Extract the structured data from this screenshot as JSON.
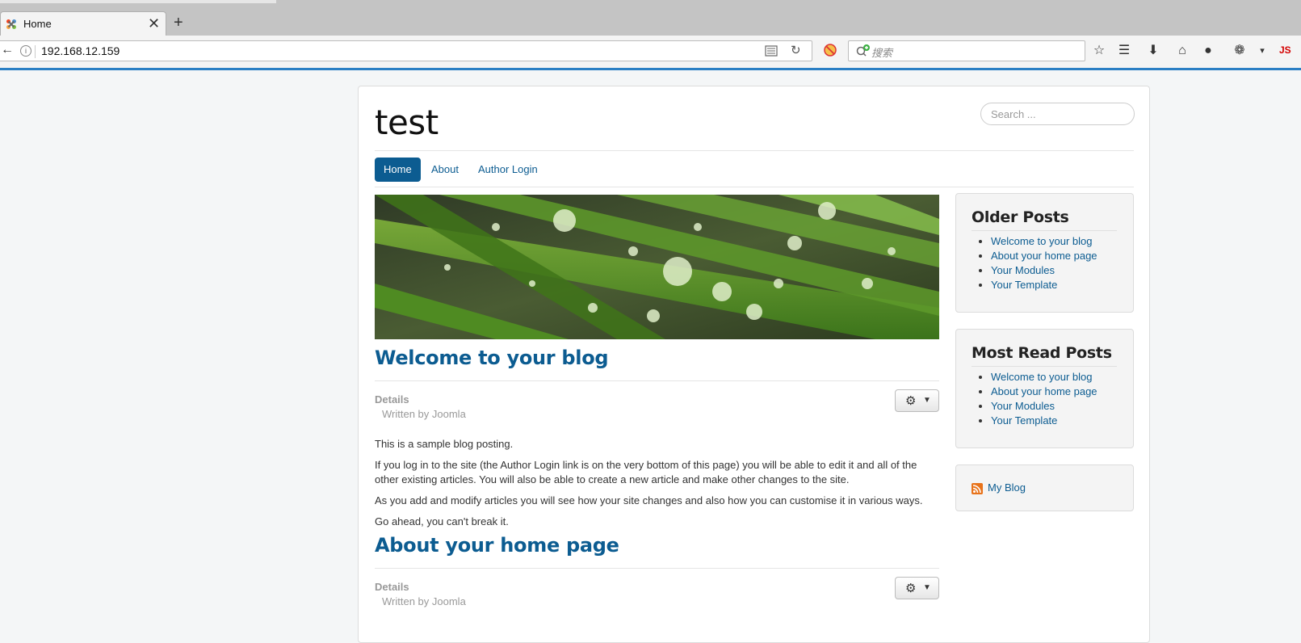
{
  "browser": {
    "tab_title": "Home",
    "tab_close": "✕",
    "new_tab": "+",
    "url": "192.168.12.159",
    "search_placeholder": "搜索",
    "js_badge": "JS",
    "accent_color": "#2b7fc4"
  },
  "site": {
    "title": "test",
    "search_placeholder": "Search ...",
    "menu": [
      {
        "label": "Home",
        "active": true
      },
      {
        "label": "About",
        "active": false
      },
      {
        "label": "Author Login",
        "active": false
      }
    ],
    "link_color": "#0c5c91"
  },
  "articles": [
    {
      "title": "Welcome to your blog",
      "details_label": "Details",
      "written_by": "Written by Joomla",
      "paragraphs": [
        "This is a sample blog posting.",
        "If you log in to the site (the Author Login link is on the very bottom of this page) you will be able to edit it and all of the other existing articles. You will also be able to create a new article and make other changes to the site.",
        "As you add and modify articles you will see how your site changes and also how you can customise it in various ways.",
        "Go ahead, you can't break it."
      ]
    },
    {
      "title": "About your home page",
      "details_label": "Details",
      "written_by": "Written by Joomla"
    }
  ],
  "sidebar": {
    "older_posts": {
      "title": "Older Posts",
      "items": [
        "Welcome to your blog",
        "About your home page",
        "Your Modules",
        "Your Template"
      ]
    },
    "most_read": {
      "title": "Most Read Posts",
      "items": [
        "Welcome to your blog",
        "About your home page",
        "Your Modules",
        "Your Template"
      ]
    },
    "feed": {
      "label": "My Blog"
    }
  }
}
